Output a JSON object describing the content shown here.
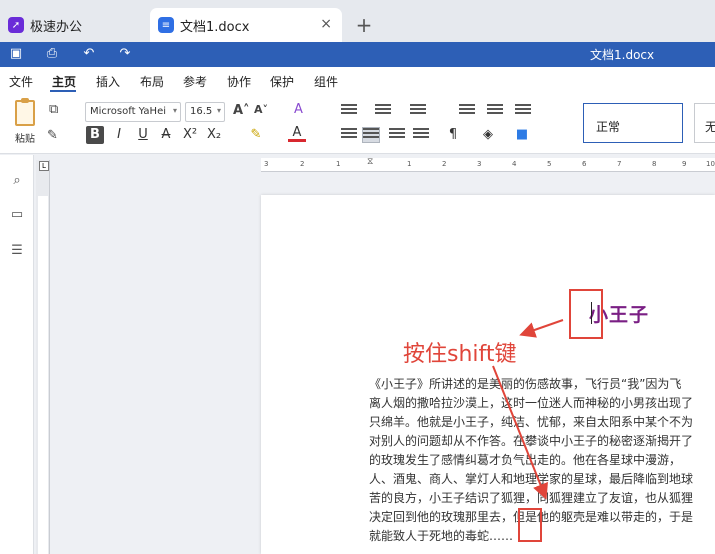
{
  "tabs": [
    {
      "label": "极速办公",
      "icon": "rocket-icon"
    },
    {
      "label": "文档1.docx",
      "icon": "document-icon",
      "close": "×"
    }
  ],
  "new_tab_label": "+",
  "titlebar": {
    "title": "文档1.docx"
  },
  "menu": [
    "文件",
    "主页",
    "插入",
    "布局",
    "参考",
    "协作",
    "保护",
    "组件"
  ],
  "ribbon": {
    "paste_label": "粘贴",
    "font_name": "Microsoft YaHei",
    "font_size": "16.5",
    "style_normal": "正常",
    "style_next": "无"
  },
  "ruler_labels": [
    "3",
    "2",
    "1",
    "1",
    "2",
    "3",
    "4",
    "5",
    "6",
    "7",
    "8",
    "9",
    "10"
  ],
  "document": {
    "title": "小王子",
    "annotation": "按住shift键",
    "paragraph_lines": [
      "《小王子》所讲述的是美丽的伤感故事，飞行员“我”因为飞",
      "离人烟的撒哈拉沙漠上，这时一位迷人而神秘的小男孩出现了",
      "只绵羊。他就是小王子，纯洁、忧郁，来自太阳系中某个不为",
      "对别人的问题却从不作答。在攀谈中小王子的秘密逐渐揭开了",
      "的玫瑰发生了感情纠葛才负气出走的。他在各星球中漫游，",
      "人、酒鬼、商人、掌灯人和地理学家的星球，最后降临到地球",
      "苦的良方，小王子结识了狐狸，同狐狸建立了友谊，也从狐狸",
      "决定回到他的玫瑰那里去，但是他的躯壳是难以带走的，于是",
      "就能致人于死地的毒蛇……"
    ]
  },
  "colors": {
    "titlebar": "#2d5fb6",
    "title_text": "#7a1f84",
    "annotation": "#e0453a"
  }
}
